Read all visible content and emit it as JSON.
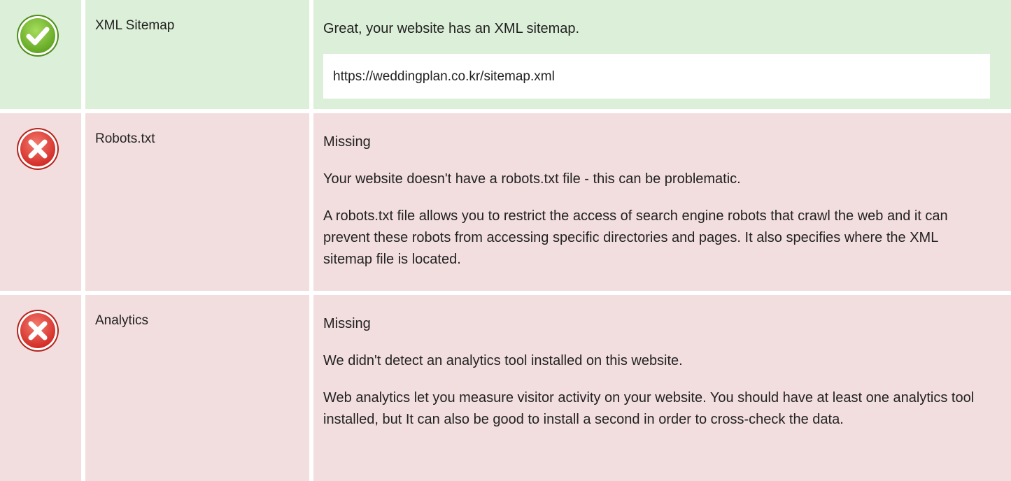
{
  "colors": {
    "pass_background": "#dcefd8",
    "fail_background": "#f3dedf",
    "pass_icon": "#78bd37",
    "fail_icon": "#e0403a"
  },
  "rows": [
    {
      "status": "pass",
      "icon": "check-circle-icon",
      "name": "XML Sitemap",
      "message": "Great, your website has an XML sitemap.",
      "url": "https://weddingplan.co.kr/sitemap.xml"
    },
    {
      "status": "fail",
      "icon": "x-circle-icon",
      "name": "Robots.txt",
      "status_text": "Missing",
      "message": "Your website doesn't have a robots.txt file - this can be problematic.",
      "description": "A robots.txt file allows you to restrict the access of search engine robots that crawl the web and it can prevent these robots from accessing specific directories and pages. It also specifies where the XML sitemap file is located."
    },
    {
      "status": "fail",
      "icon": "x-circle-icon",
      "name": "Analytics",
      "status_text": "Missing",
      "message": "We didn't detect an analytics tool installed on this website.",
      "description": "Web analytics let you measure visitor activity on your website. You should have at least one analytics tool installed, but It can also be good to install a second in order to cross-check the data."
    }
  ]
}
